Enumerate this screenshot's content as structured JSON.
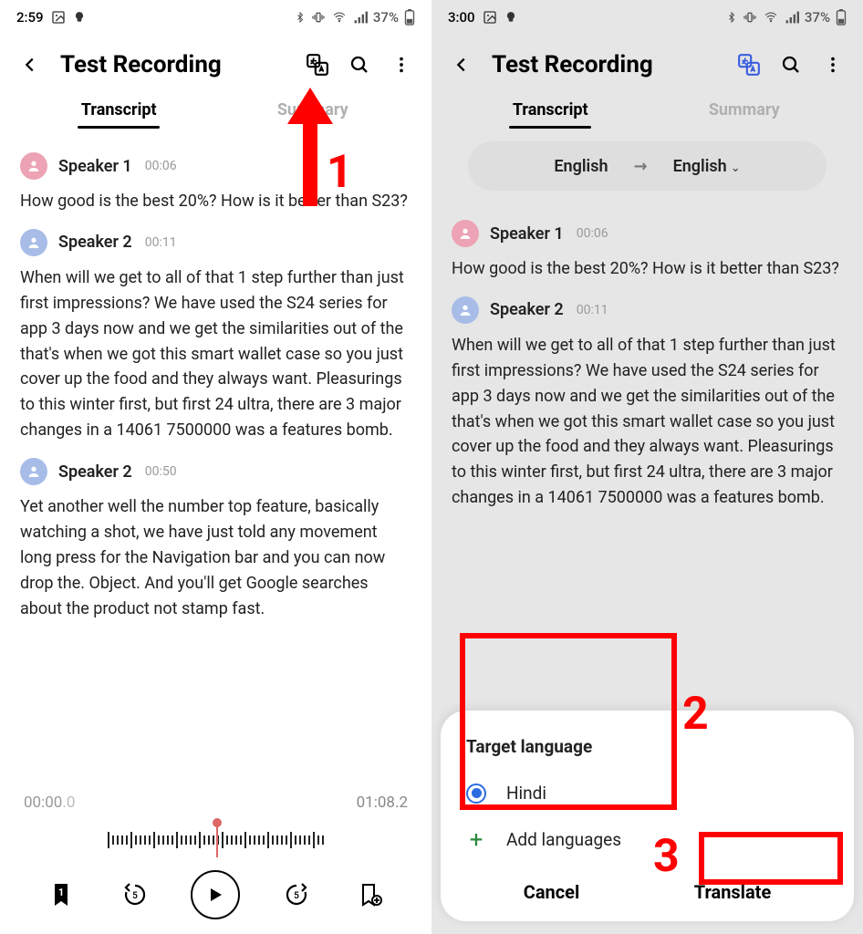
{
  "left": {
    "status": {
      "time": "2:59",
      "battery_pct": "37%"
    },
    "header": {
      "title": "Test Recording"
    },
    "tabs": {
      "transcript": "Transcript",
      "summary": "Summary"
    },
    "transcript": [
      {
        "speaker": "Speaker 1",
        "ts": "00:06",
        "color": "pink",
        "text": "How good is the best 20%? How is it better than S23?"
      },
      {
        "speaker": "Speaker 2",
        "ts": "00:11",
        "color": "blue",
        "text": "When will we get to all of that 1 step further than just first impressions? We have used the S24 series for app 3 days now and we get the similarities out of the that's when we got this smart wallet case so you just cover up the food and they always want. Pleasurings to this winter first, but first 24 ultra, there are 3 major changes in a 14061 7500000 was a features bomb."
      },
      {
        "speaker": "Speaker 2",
        "ts": "00:50",
        "color": "blue",
        "text": "Yet another well the number top feature, basically watching a shot, we have just told any movement long press for the Navigation bar and you can now drop the. Object. And you'll get Google searches about the product not stamp fast."
      }
    ],
    "player": {
      "current": "00:00",
      "current_dec": ".0",
      "total": "01:08.2",
      "bookmark_count": "1"
    }
  },
  "right": {
    "status": {
      "time": "3:00",
      "battery_pct": "37%"
    },
    "header": {
      "title": "Test Recording"
    },
    "tabs": {
      "transcript": "Transcript",
      "summary": "Summary"
    },
    "lang": {
      "from": "English",
      "to": "English"
    },
    "transcript": [
      {
        "speaker": "Speaker 1",
        "ts": "00:06",
        "color": "pink",
        "text": "How good is the best 20%? How is it better than S23?"
      },
      {
        "speaker": "Speaker 2",
        "ts": "00:11",
        "color": "blue",
        "text": "When will we get to all of that 1 step further than just first impressions? We have used the S24 series for app 3 days now and we get the similarities out of the that's when we got this smart wallet case so you just cover up the food and they always want. Pleasurings to this winter first, but first 24 ultra, there are 3 major changes in a 14061 7500000 was a features bomb."
      }
    ],
    "sheet": {
      "title": "Target language",
      "options": {
        "hindi": "Hindi",
        "add": "Add languages"
      },
      "actions": {
        "cancel": "Cancel",
        "translate": "Translate"
      }
    }
  },
  "annotations": {
    "one": "1",
    "two": "2",
    "three": "3"
  }
}
